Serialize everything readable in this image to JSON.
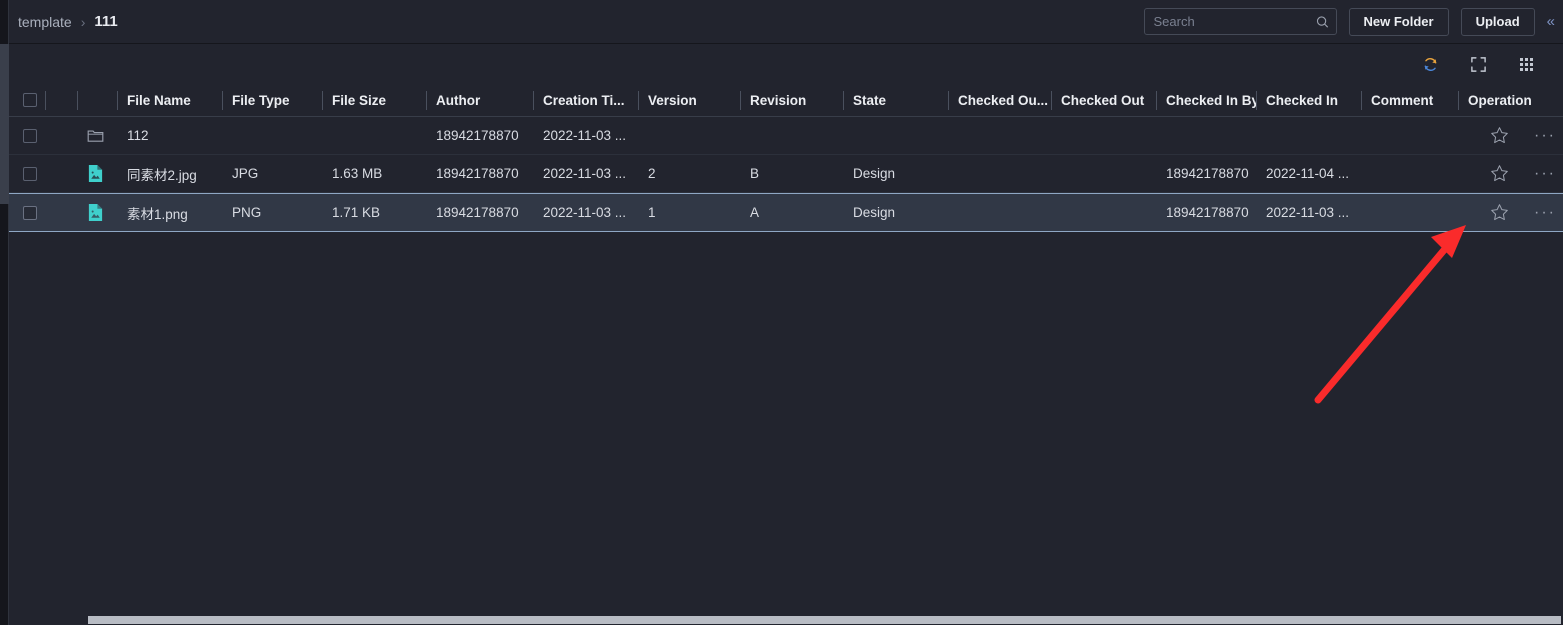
{
  "header": {
    "breadcrumb": {
      "root": "template",
      "separator": "›",
      "current": "111"
    },
    "search": {
      "value": "",
      "placeholder": "Search",
      "icon": "search-icon"
    },
    "new_folder_label": "New Folder",
    "upload_label": "Upload",
    "collapse_icon": "«"
  },
  "toolbar": {
    "refresh_icon": "refresh-icon",
    "fullscreen_icon": "fullscreen-icon",
    "grid_view_icon": "grid-view-icon"
  },
  "table": {
    "columns": [
      {
        "key": "check",
        "label": ""
      },
      {
        "key": "blank1",
        "label": ""
      },
      {
        "key": "icon",
        "label": ""
      },
      {
        "key": "name",
        "label": "File Name"
      },
      {
        "key": "type",
        "label": "File Type"
      },
      {
        "key": "size",
        "label": "File Size"
      },
      {
        "key": "author",
        "label": "Author"
      },
      {
        "key": "ctime",
        "label": "Creation Ti..."
      },
      {
        "key": "version",
        "label": "Version"
      },
      {
        "key": "revision",
        "label": "Revision"
      },
      {
        "key": "state",
        "label": "State"
      },
      {
        "key": "cou",
        "label": "Checked Ou..."
      },
      {
        "key": "cout",
        "label": "Checked Out"
      },
      {
        "key": "cib",
        "label": "Checked In By"
      },
      {
        "key": "cin",
        "label": "Checked In"
      },
      {
        "key": "comment",
        "label": "Comment"
      },
      {
        "key": "op",
        "label": "Operation"
      }
    ],
    "rows": [
      {
        "icon": "folder-icon",
        "name": "112",
        "type": "",
        "size": "",
        "author": "18942178870",
        "ctime": "2022-11-03 ...",
        "version": "",
        "revision": "",
        "state": "",
        "cou": "",
        "cout": "",
        "cib": "",
        "cin": "",
        "comment": "",
        "selected": false,
        "favorite_icon": "star-icon",
        "more_icon": "···"
      },
      {
        "icon": "image-file-icon",
        "name": "同素材2.jpg",
        "type": "JPG",
        "size": "1.63 MB",
        "author": "18942178870",
        "ctime": "2022-11-03 ...",
        "version": "2",
        "revision": "B",
        "state": "Design",
        "cou": "",
        "cout": "",
        "cib": "18942178870",
        "cin": "2022-11-04 ...",
        "comment": "",
        "selected": false,
        "favorite_icon": "star-icon",
        "more_icon": "···"
      },
      {
        "icon": "image-file-icon",
        "name": "素材1.png",
        "type": "PNG",
        "size": "1.71 KB",
        "author": "18942178870",
        "ctime": "2022-11-03 ...",
        "version": "1",
        "revision": "A",
        "state": "Design",
        "cou": "",
        "cout": "",
        "cib": "18942178870",
        "cin": "2022-11-03 ...",
        "comment": "",
        "selected": true,
        "favorite_icon": "star-icon",
        "more_icon": "···"
      }
    ]
  },
  "annotation": {
    "arrow_color": "#fa2b2b",
    "type": "arrow-pointing-to-favorite-star"
  },
  "colors": {
    "background": "#22242e",
    "row_selected": "#313846",
    "selected_border": "#8fa7c4",
    "text_primary": "#eceef2",
    "text_secondary": "#d9dce3",
    "file_icon": "#3fd0cc",
    "annotation_red": "#fa2b2b"
  }
}
